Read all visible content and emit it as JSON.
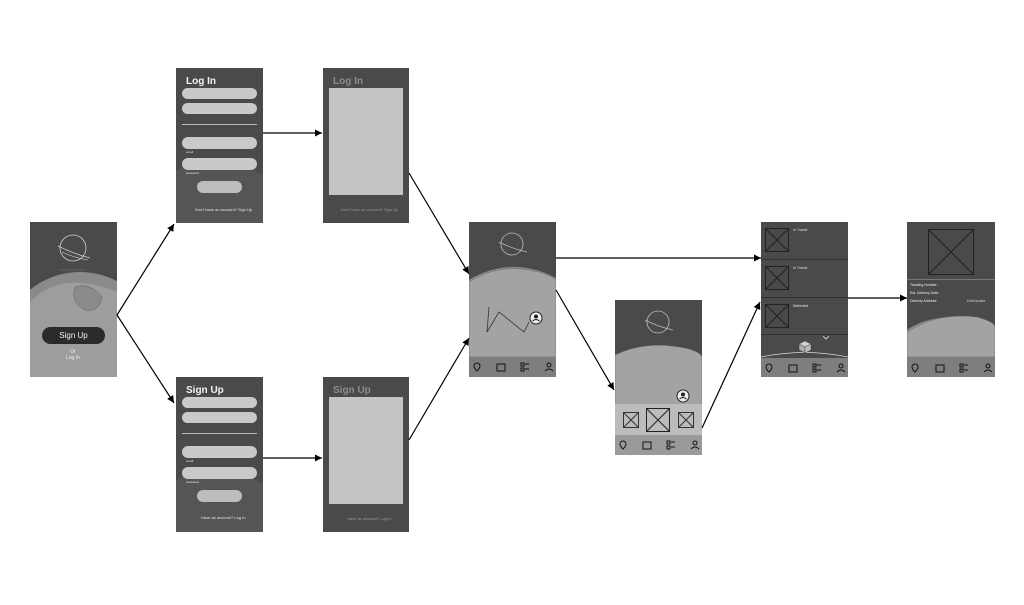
{
  "start": {
    "signup_button": "Sign Up",
    "or_text": "Or",
    "login_text": "Log In"
  },
  "login_form": {
    "title": "Log In",
    "email_label": "email",
    "password_label": "password",
    "footer": "Don't have an account? Sign Up"
  },
  "login_loading": {
    "title": "Log In",
    "footer": "Don't have an account? Sign Up"
  },
  "signup_form": {
    "title": "Sign Up",
    "email_label": "email",
    "password_label": "password",
    "footer": "Have an account? Log In"
  },
  "signup_loading": {
    "title": "Sign Up",
    "footer": "Have an account? Log In"
  },
  "orders": {
    "card1_label": "In Transit",
    "card2_label": "In Transit",
    "card3_label": "Delivered"
  },
  "detail": {
    "tracking": "Tracking Number:",
    "delivery": "Est. Delivery Date:",
    "address": "Delivery Address:",
    "edit": "Edit/Update"
  },
  "nav_icons": [
    "map-pin-icon",
    "package-icon",
    "list-icon",
    "profile-icon"
  ],
  "colors": {
    "screen_bg": "#4a4a4a",
    "navbar": "#7e7e7e",
    "field": "#c9c9c9",
    "arrow": "#000000"
  }
}
